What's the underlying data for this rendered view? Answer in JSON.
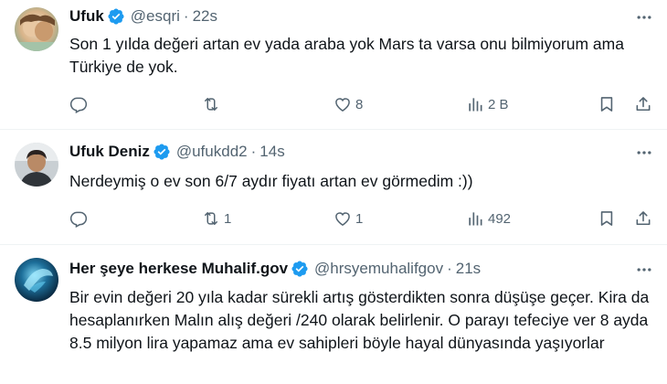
{
  "tweets": [
    {
      "name": "Ufuk",
      "handle": "@esqri",
      "dot": "·",
      "time": "22s",
      "text": "Son 1 yılda değeri artan ev yada araba yok Mars ta varsa onu bilmiyorum ama Türkiye de yok.",
      "reply_count": "",
      "retweet_count": "",
      "like_count": "8",
      "view_count": "2 B"
    },
    {
      "name": "Ufuk Deniz",
      "handle": "@ufukdd2",
      "dot": "·",
      "time": "14s",
      "text": "Nerdeymiş o ev son 6/7 aydır fiyatı artan ev görmedim :))",
      "reply_count": "",
      "retweet_count": "1",
      "like_count": "1",
      "view_count": "492"
    },
    {
      "name": "Her şeye herkese Muhalif.gov",
      "handle": "@hrsyemuhalifgov",
      "dot": "·",
      "time": "21s",
      "text": "Bir evin değeri 20 yıla kadar sürekli artış gösterdikten sonra düşüşe geçer. Kira da hesaplanırken Malın alış değeri /240 olarak belirlenir. O parayı tefeciye ver 8 ayda 8.5 milyon lira yapamaz ama ev sahipleri böyle hayal dünyasında yaşıyorlar"
    }
  ],
  "colors": {
    "verified": "#1d9bf0",
    "secondary_text": "#536471",
    "divider": "#eff3f4"
  },
  "icons": [
    "verified-badge-icon",
    "more-icon",
    "reply-icon",
    "retweet-icon",
    "like-icon",
    "views-icon",
    "bookmark-icon",
    "share-icon"
  ]
}
